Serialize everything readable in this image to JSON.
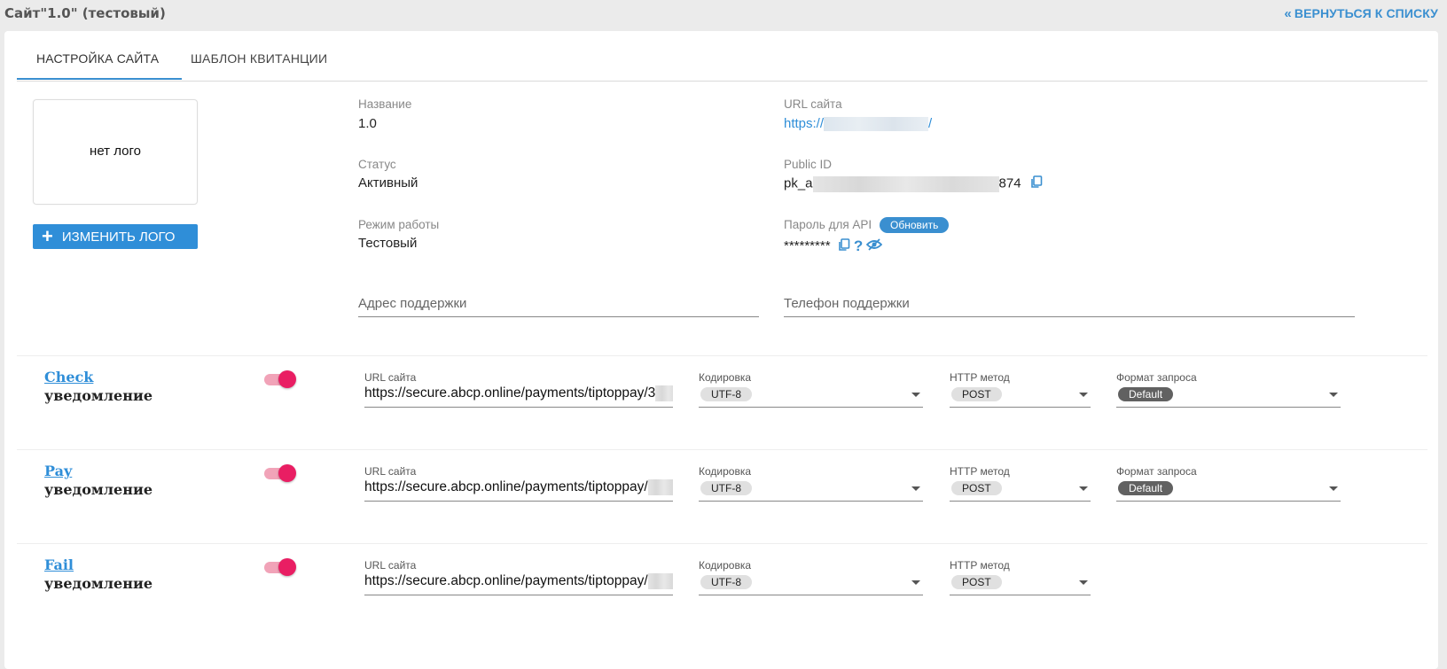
{
  "header": {
    "title": "Сайт\"1.0\" (тестовый)",
    "back_label": "ВЕРНУТЬСЯ К СПИСКУ"
  },
  "tabs": [
    {
      "label": "НАСТРОЙКА САЙТА",
      "active": true
    },
    {
      "label": "ШАБЛОН КВИТАНЦИИ",
      "active": false
    }
  ],
  "logo": {
    "placeholder": "нет лого",
    "change_button": "ИЗМЕНИТЬ ЛОГО"
  },
  "fields": {
    "name_label": "Название",
    "name_value": "1.0",
    "status_label": "Статус",
    "status_value": "Активный",
    "mode_label": "Режим работы",
    "mode_value": "Тестовый",
    "url_label": "URL сайта",
    "url_prefix": "https://",
    "url_suffix": "/",
    "public_id_label": "Public ID",
    "public_id_prefix": "pk_a",
    "public_id_suffix": "874",
    "api_password_label": "Пароль для API",
    "api_refresh": "Обновить",
    "api_password_value": "*********",
    "support_address_placeholder": "Адрес поддержки",
    "support_phone_placeholder": "Телефон поддержки"
  },
  "notifications": [
    {
      "title": "Check",
      "subtitle": "уведомление",
      "enabled": true,
      "url_label": "URL сайта",
      "url_value": "https://secure.abcp.online/payments/tiptoppay/3",
      "encoding_label": "Кодировка",
      "encoding_value": "UTF-8",
      "method_label": "HTTP метод",
      "method_value": "POST",
      "format_label": "Формат запроса",
      "format_value": "Default"
    },
    {
      "title": "Pay",
      "subtitle": "уведомление",
      "enabled": true,
      "url_label": "URL сайта",
      "url_value": "https://secure.abcp.online/payments/tiptoppay/",
      "encoding_label": "Кодировка",
      "encoding_value": "UTF-8",
      "method_label": "HTTP метод",
      "method_value": "POST",
      "format_label": "Формат запроса",
      "format_value": "Default"
    },
    {
      "title": "Fail",
      "subtitle": "уведомление",
      "enabled": true,
      "url_label": "URL сайта",
      "url_value": "https://secure.abcp.online/payments/tiptoppay/",
      "encoding_label": "Кодировка",
      "encoding_value": "UTF-8",
      "method_label": "HTTP метод",
      "method_value": "POST"
    }
  ],
  "icons": {
    "back": "double-chevron-left-icon",
    "plus": "plus-icon",
    "copy": "copy-icon",
    "help": "question-icon",
    "visibility": "eye-off-icon"
  }
}
